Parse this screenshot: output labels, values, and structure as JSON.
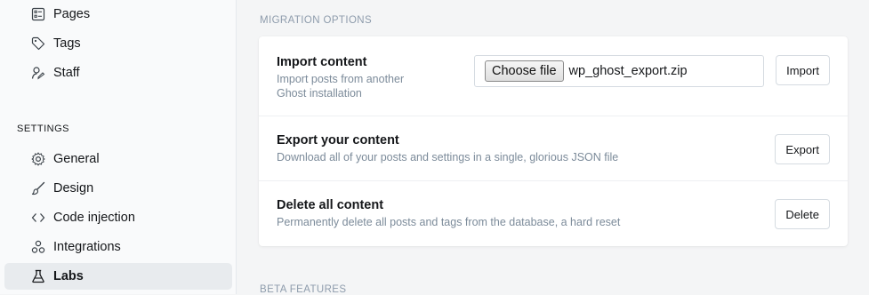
{
  "sidebar": {
    "top_items": [
      {
        "label": "Pages",
        "icon": "pages-icon"
      },
      {
        "label": "Tags",
        "icon": "tag-icon"
      },
      {
        "label": "Staff",
        "icon": "staff-icon"
      }
    ],
    "settings_label": "SETTINGS",
    "settings_items": [
      {
        "label": "General",
        "icon": "gear-icon"
      },
      {
        "label": "Design",
        "icon": "brush-icon"
      },
      {
        "label": "Code injection",
        "icon": "code-icon"
      },
      {
        "label": "Integrations",
        "icon": "integrations-icon"
      },
      {
        "label": "Labs",
        "icon": "flask-icon",
        "active": true
      }
    ]
  },
  "main": {
    "migration_heading": "Migration options",
    "beta_heading": "Beta features",
    "import": {
      "title": "Import content",
      "desc_line1": "Import posts from another",
      "desc_line2": "Ghost installation",
      "choose_label": "Choose file",
      "file_name": "wp_ghost_export.zip",
      "button": "Import"
    },
    "export": {
      "title": "Export your content",
      "desc": "Download all of your posts and settings in a single, glorious JSON file",
      "button": "Export"
    },
    "delete": {
      "title": "Delete all content",
      "desc": "Permanently delete all posts and tags from the database, a hard reset",
      "button": "Delete"
    }
  }
}
